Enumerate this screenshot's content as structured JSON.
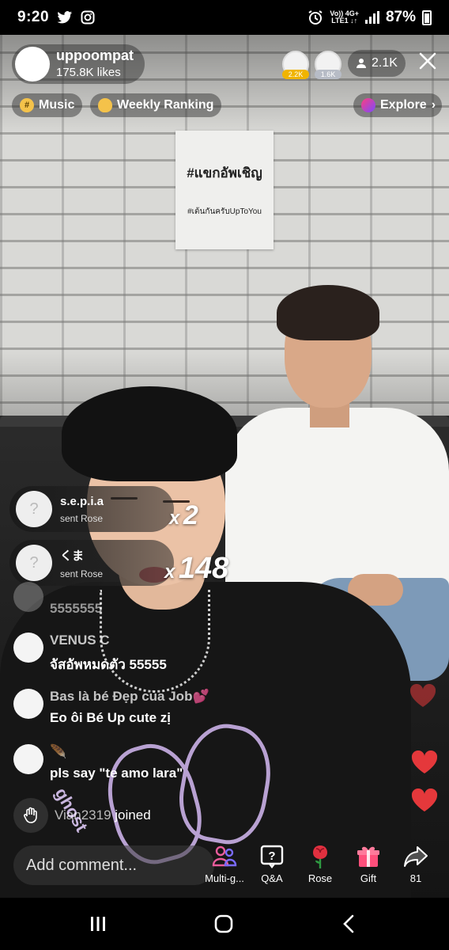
{
  "status_bar": {
    "time": "9:20",
    "network_top": "Vo)) 4G+",
    "network_bottom": "LTE1 ↓↑",
    "battery_percent": "87%"
  },
  "live": {
    "host": {
      "name": "uppoompat",
      "likes": "175.8K likes"
    },
    "top_viewers": [
      {
        "badge": "2.2K",
        "badge_color": "#f0b400"
      },
      {
        "badge": "1.6K",
        "badge_color": "#b7bcc6"
      }
    ],
    "viewer_count": "2.1K",
    "chips": {
      "music": "Music",
      "ranking": "Weekly Ranking",
      "explore": "Explore"
    }
  },
  "poster": {
    "line1": "#แขกอัพเชิญ",
    "line2": "#เต้นกันครับUpToYou"
  },
  "gifts": [
    {
      "user": "s.e.p.i.a",
      "action": "sent Rose",
      "count_prefix": "x",
      "count": "2"
    },
    {
      "user": "くま",
      "action": "sent Rose",
      "count_prefix": "x",
      "count": "148"
    }
  ],
  "comments": [
    {
      "user": "",
      "text": "5555555"
    },
    {
      "user": "VENUS C",
      "text": "จัสอัพหมดตัว 55555"
    },
    {
      "user": "Bas là bé Đẹp của Job💕",
      "text": "Eo ôi Bé Up cute zị"
    },
    {
      "user": "🪶",
      "text": "pls say \"te amo lara\""
    }
  ],
  "joined": {
    "user": "Vian2319",
    "suffix": " joined"
  },
  "bottom": {
    "comment_placeholder": "Add comment...",
    "actions": [
      {
        "label": "Multi-g...",
        "icon": "multi-guest-icon"
      },
      {
        "label": "Q&A",
        "icon": "qa-icon"
      },
      {
        "label": "Rose",
        "icon": "rose-icon"
      },
      {
        "label": "Gift",
        "icon": "gift-icon"
      },
      {
        "label": "81",
        "icon": "share-icon"
      }
    ]
  },
  "colors": {
    "accent_pink": "#e0245e",
    "heart_red": "#e5383b",
    "gold": "#f0b400"
  }
}
